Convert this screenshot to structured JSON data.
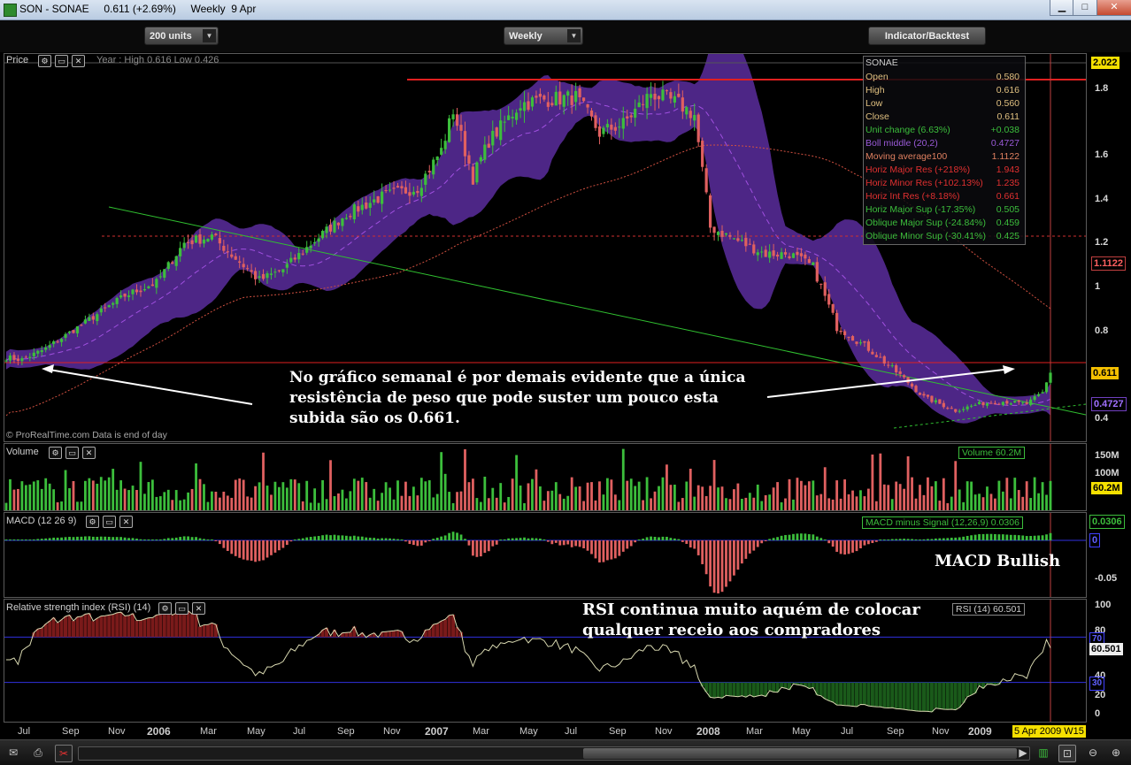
{
  "window": {
    "title": "SON - SONAE     0.611 (+2.69%)     Weekly  9 Apr",
    "buttons": [
      "minimize",
      "maximize",
      "close"
    ]
  },
  "toolbar": {
    "units_select": "200 units",
    "period_select": "Weekly",
    "indicator_button": "Indicator/Backtest"
  },
  "price_panel": {
    "title": "Price",
    "year_range": "Year : High 0.616 Low 0.426",
    "footer": "© ProRealTime.com  Data is end of day",
    "tags": {
      "top": "2.022",
      "ma": "1.1122",
      "price": "0.611",
      "boll": "0.4727"
    },
    "colors": {
      "bollinger": "#5a2d9e",
      "up": "#3cbe3c",
      "down": "#e06060",
      "resistance": "#e02020"
    }
  },
  "info_box": {
    "title": "SONAE",
    "rows": [
      {
        "label": "Open",
        "value": "0.580",
        "color": "#e0c080"
      },
      {
        "label": "High",
        "value": "0.616",
        "color": "#e0c080"
      },
      {
        "label": "Low",
        "value": "0.560",
        "color": "#e0c080"
      },
      {
        "label": "Close",
        "value": "0.611",
        "color": "#e0c080"
      },
      {
        "label": "Unit change (6.63%)",
        "value": "+0.038",
        "color": "#3cbe3c"
      },
      {
        "label": "Boll middle (20,2)",
        "value": "0.4727",
        "color": "#9a5ad8"
      },
      {
        "label": "Moving average100",
        "value": "1.1122",
        "color": "#e08060"
      },
      {
        "label": "Horiz Major Res (+218%)",
        "value": "1.943",
        "color": "#e03030"
      },
      {
        "label": "Horiz Minor Res (+102.13%)",
        "value": "1.235",
        "color": "#e03030"
      },
      {
        "label": "Horiz Int Res (+8.18%)",
        "value": "0.661",
        "color": "#e03030"
      },
      {
        "label": "Horiz Major Sup (-17.35%)",
        "value": "0.505",
        "color": "#3cbe3c"
      },
      {
        "label": "Oblique Major Sup (-24.84%)",
        "value": "0.459",
        "color": "#3cbe3c"
      },
      {
        "label": "Oblique Minor Sup (-30.41%)",
        "value": "0.425",
        "color": "#3cbe3c"
      }
    ]
  },
  "annotations": {
    "price_note": [
      "No gráfico semanal é por demais evidente que a única",
      "resistência de peso que pode suster um pouco esta",
      "subida são os 0.661."
    ],
    "macd_note": "MACD Bullish",
    "rsi_note": [
      "RSI continua muito aquém de colocar",
      "qualquer receio aos compradores"
    ]
  },
  "volume_panel": {
    "title": "Volume",
    "legend": "Volume 60.2M",
    "tag": "60.2M"
  },
  "macd_panel": {
    "title": "MACD (12 26 9)",
    "legend": "MACD minus Signal (12,26,9) 0.0306",
    "tag": "0.0306",
    "zero_tag": "0"
  },
  "rsi_panel": {
    "title": "Relative strength index (RSI) (14)",
    "legend": "RSI (14) 60.501",
    "tag": "60.501",
    "upper_tag": "70",
    "lower_tag": "30"
  },
  "x_axis": {
    "labels": [
      {
        "text": "Jul",
        "year": false
      },
      {
        "text": "Sep",
        "year": false
      },
      {
        "text": "Nov",
        "year": false
      },
      {
        "text": "2006",
        "year": true
      },
      {
        "text": "Mar",
        "year": false
      },
      {
        "text": "May",
        "year": false
      },
      {
        "text": "Jul",
        "year": false
      },
      {
        "text": "Sep",
        "year": false
      },
      {
        "text": "Nov",
        "year": false
      },
      {
        "text": "2007",
        "year": true
      },
      {
        "text": "Mar",
        "year": false
      },
      {
        "text": "May",
        "year": false
      },
      {
        "text": "Jul",
        "year": false
      },
      {
        "text": "Sep",
        "year": false
      },
      {
        "text": "Nov",
        "year": false
      },
      {
        "text": "2008",
        "year": true
      },
      {
        "text": "Mar",
        "year": false
      },
      {
        "text": "May",
        "year": false
      },
      {
        "text": "Jul",
        "year": false
      },
      {
        "text": "Sep",
        "year": false
      },
      {
        "text": "Nov",
        "year": false
      },
      {
        "text": "2009",
        "year": true
      }
    ],
    "current_date": "5 Apr 2009 W15"
  },
  "chart_data": [
    {
      "type": "candlestick",
      "title": "Price",
      "y_ticks": [
        0.4,
        0.6,
        0.8,
        1,
        1.2,
        1.4,
        1.6,
        1.8
      ],
      "ylim": [
        0.33,
        2.04
      ],
      "x": "weekly 2005-06 .. 2009-04",
      "close_anchors": [
        [
          0,
          0.68
        ],
        [
          4,
          0.67
        ],
        [
          10,
          0.72
        ],
        [
          20,
          0.84
        ],
        [
          30,
          0.96
        ],
        [
          38,
          1.02
        ],
        [
          45,
          1.2
        ],
        [
          52,
          1.23
        ],
        [
          58,
          1.13
        ],
        [
          64,
          1.03
        ],
        [
          70,
          1.08
        ],
        [
          78,
          1.21
        ],
        [
          86,
          1.33
        ],
        [
          95,
          1.41
        ],
        [
          104,
          1.45
        ],
        [
          110,
          1.62
        ],
        [
          113,
          1.8
        ],
        [
          118,
          1.5
        ],
        [
          122,
          1.66
        ],
        [
          130,
          1.83
        ],
        [
          136,
          1.85
        ],
        [
          144,
          1.86
        ],
        [
          150,
          1.7
        ],
        [
          156,
          1.74
        ],
        [
          163,
          1.88
        ],
        [
          170,
          1.83
        ],
        [
          174,
          1.78
        ],
        [
          178,
          1.27
        ],
        [
          186,
          1.2
        ],
        [
          192,
          1.15
        ],
        [
          198,
          1.15
        ],
        [
          204,
          1.09
        ],
        [
          210,
          0.82
        ],
        [
          218,
          0.72
        ],
        [
          226,
          0.6
        ],
        [
          232,
          0.5
        ],
        [
          240,
          0.44
        ],
        [
          246,
          0.47
        ],
        [
          252,
          0.48
        ],
        [
          258,
          0.47
        ],
        [
          262,
          0.52
        ],
        [
          264,
          0.611
        ]
      ],
      "last": {
        "open": 0.58,
        "high": 0.616,
        "low": 0.56,
        "close": 0.611
      },
      "moving_average_100": {
        "last": 1.1122
      },
      "bollinger_middle_20_2": {
        "last": 0.4727
      },
      "horizontal_resistance": [
        1.943,
        1.235,
        0.661
      ]
    },
    {
      "type": "bar",
      "title": "Volume",
      "y_ticks": [
        "50M",
        "100M",
        "150M"
      ],
      "last": "60.2M"
    },
    {
      "type": "bar",
      "title": "MACD (12 26 9)",
      "y_ticks": [
        0,
        -0.05
      ],
      "last": 0.0306
    },
    {
      "type": "line",
      "title": "Relative strength index (RSI) (14)",
      "y_ticks": [
        20,
        40,
        60,
        80,
        100
      ],
      "levels": [
        30,
        70
      ],
      "last": 60.501
    }
  ]
}
